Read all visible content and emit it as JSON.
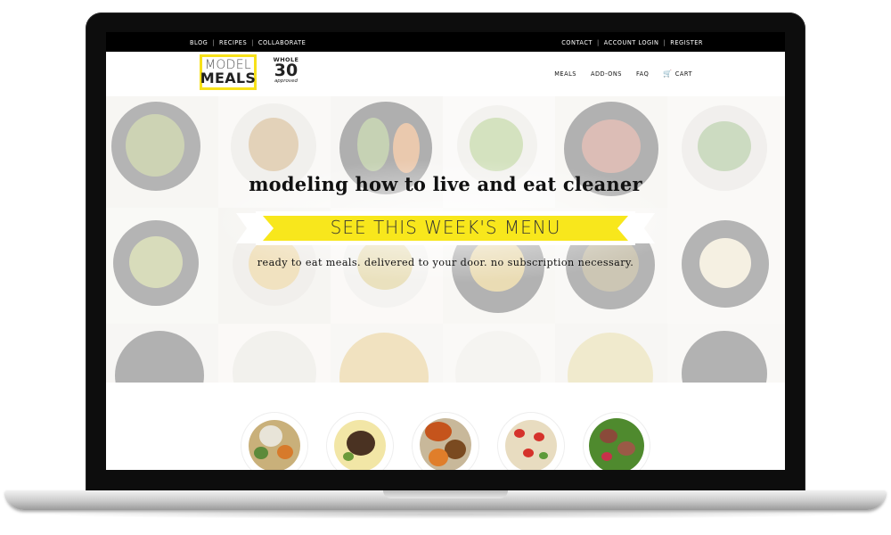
{
  "topbar": {
    "left_links": [
      "BLOG",
      "RECIPES",
      "COLLABORATE"
    ],
    "right_links": [
      "CONTACT",
      "ACCOUNT LOGIN",
      "REGISTER"
    ]
  },
  "brand": {
    "logo_line1": "MODEL",
    "logo_line2": "MEALS",
    "logo_border_color": "#f7e11a",
    "badge_top": "WHOLE",
    "badge_number": "30",
    "badge_bottom": "approved"
  },
  "nav": {
    "items": [
      "MEALS",
      "ADD-ONS",
      "FAQ"
    ],
    "cart_label": "CART",
    "cart_icon": "cart-icon"
  },
  "hero": {
    "title": "modeling how to live and eat cleaner",
    "cta_label": "SEE THIS WEEK'S MENU",
    "cta_color": "#f8e71c",
    "subtitle": "ready to eat meals. delivered to your door. no subscription necessary."
  },
  "meals": {
    "count": 5
  }
}
